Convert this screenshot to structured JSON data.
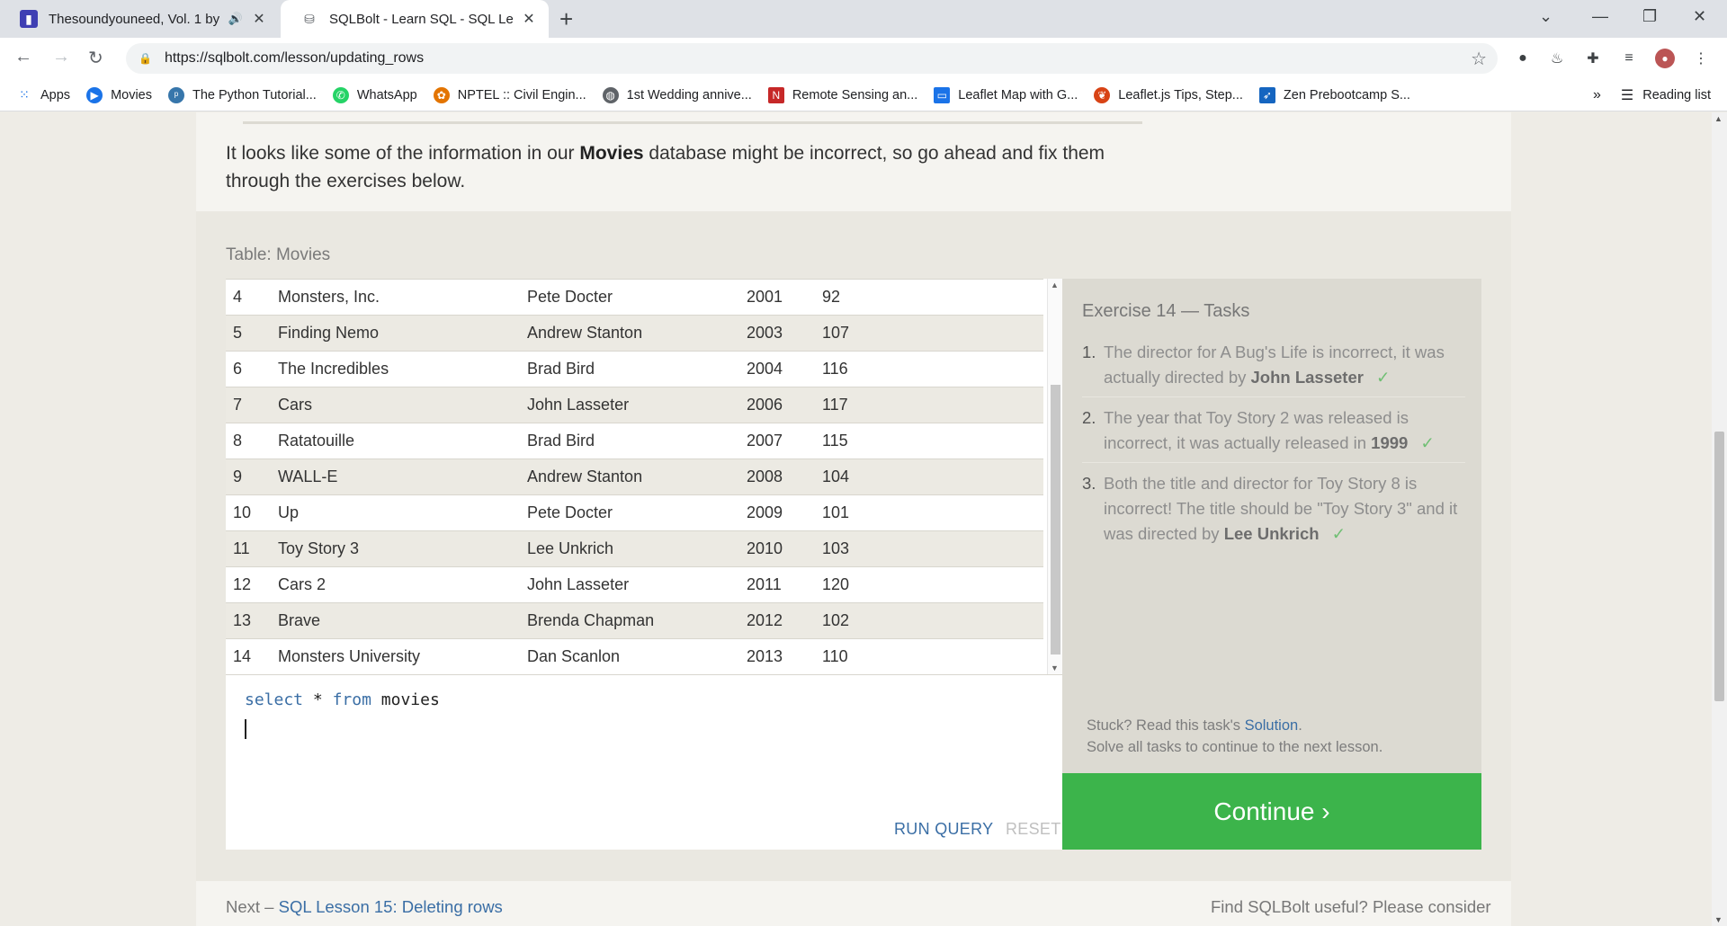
{
  "browser": {
    "tabs": [
      {
        "title": "Thesoundyouneed, Vol. 1 by",
        "icon": "bandcamp-icon"
      },
      {
        "title": "SQLBolt - Learn SQL - SQL Lesso",
        "icon": "database-icon"
      }
    ],
    "url": "https://sqlbolt.com/lesson/updating_rows",
    "bookmarks": [
      {
        "label": "Apps",
        "icon": "apps-grid-icon",
        "color": "#1a73e8"
      },
      {
        "label": "Movies",
        "icon": "play-icon",
        "color": "#1a73e8"
      },
      {
        "label": "The Python Tutorial...",
        "icon": "python-icon",
        "color": "#3776ab"
      },
      {
        "label": "WhatsApp",
        "icon": "whatsapp-icon",
        "color": "#25d366"
      },
      {
        "label": "NPTEL :: Civil Engin...",
        "icon": "nptel-icon",
        "color": "#e37400"
      },
      {
        "label": "1st Wedding annive...",
        "icon": "globe-icon",
        "color": "#5f6368"
      },
      {
        "label": "Remote Sensing an...",
        "icon": "n-logo-icon",
        "color": "#c62828"
      },
      {
        "label": "Leaflet Map with G...",
        "icon": "book-icon",
        "color": "#1a73e8"
      },
      {
        "label": "Leaflet.js Tips, Step...",
        "icon": "leaflet-icon",
        "color": "#d84315"
      },
      {
        "label": "Zen Prebootcamp S...",
        "icon": "jira-icon",
        "color": "#1565c0"
      }
    ],
    "reading_list": "Reading list",
    "overflow": "»"
  },
  "lesson": {
    "intro_before": "It looks like some of the information in our ",
    "intro_bold": "Movies",
    "intro_after": " database might be incorrect, so go ahead and fix them through the exercises below.",
    "table_label": "Table: Movies",
    "rows": [
      [
        "4",
        "Monsters, Inc.",
        "Pete Docter",
        "2001",
        "92"
      ],
      [
        "5",
        "Finding Nemo",
        "Andrew Stanton",
        "2003",
        "107"
      ],
      [
        "6",
        "The Incredibles",
        "Brad Bird",
        "2004",
        "116"
      ],
      [
        "7",
        "Cars",
        "John Lasseter",
        "2006",
        "117"
      ],
      [
        "8",
        "Ratatouille",
        "Brad Bird",
        "2007",
        "115"
      ],
      [
        "9",
        "WALL-E",
        "Andrew Stanton",
        "2008",
        "104"
      ],
      [
        "10",
        "Up",
        "Pete Docter",
        "2009",
        "101"
      ],
      [
        "11",
        "Toy Story 3",
        "Lee Unkrich",
        "2010",
        "103"
      ],
      [
        "12",
        "Cars 2",
        "John Lasseter",
        "2011",
        "120"
      ],
      [
        "13",
        "Brave",
        "Brenda Chapman",
        "2012",
        "102"
      ],
      [
        "14",
        "Monsters University",
        "Dan Scanlon",
        "2013",
        "110"
      ]
    ],
    "query": {
      "kw1": "select",
      "star": "*",
      "kw2": "from",
      "table": "movies"
    },
    "run_label": "RUN QUERY",
    "reset_label": "RESET",
    "tasks_title": "Exercise 14 — Tasks",
    "tasks": [
      {
        "num": "1.",
        "text": "The director for A Bug's Life is incorrect, it was actually directed by ",
        "bold": "John Lasseter",
        "check": "✓"
      },
      {
        "num": "2.",
        "text": "The year that Toy Story 2 was released is incorrect, it was actually released in ",
        "bold": "1999",
        "check": "✓"
      },
      {
        "num": "3.",
        "text": "Both the title and director for Toy Story 8 is incorrect! The title should be \"Toy Story 3\" and it was directed by ",
        "bold": "Lee Unkrich",
        "check": "✓"
      }
    ],
    "stuck_before": "Stuck? Read this task's ",
    "stuck_link": "Solution",
    "stuck_after": ".",
    "solve_all": "Solve all tasks to continue to the next lesson.",
    "continue_label": "Continue ›",
    "next_prefix": "Next – ",
    "next_link": "SQL Lesson 15: Deleting rows",
    "useful": "Find SQLBolt useful? Please consider"
  }
}
